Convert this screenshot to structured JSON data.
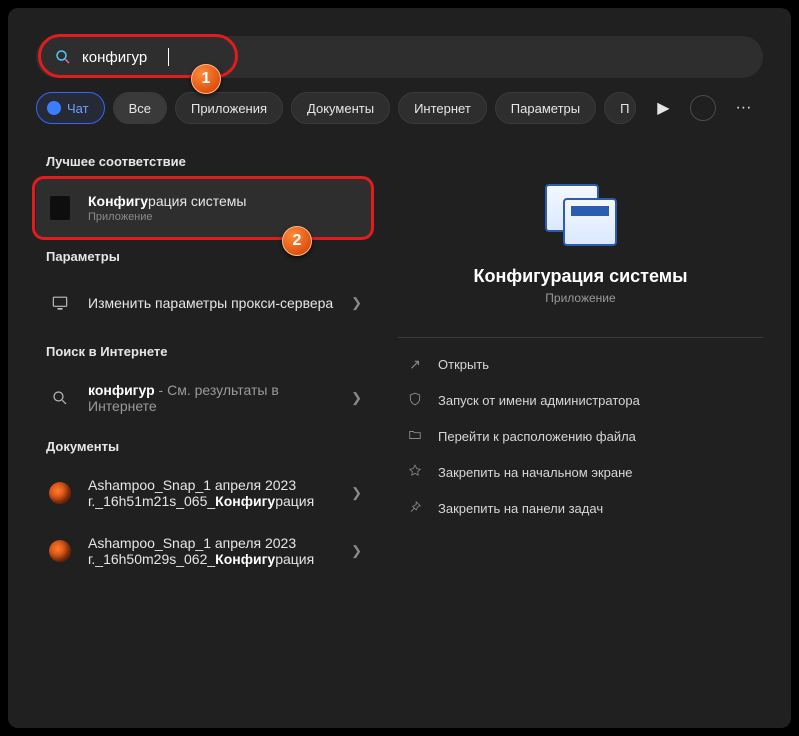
{
  "search": {
    "value": "конфигур"
  },
  "chips": {
    "chat": "Чат",
    "all": "Все",
    "apps": "Приложения",
    "docs": "Документы",
    "internet": "Интернет",
    "params": "Параметры",
    "partial": "П"
  },
  "sections": {
    "best": "Лучшее соответствие",
    "params": "Параметры",
    "web": "Поиск в Интернете",
    "docs": "Документы"
  },
  "left": {
    "best": {
      "title_prefix": "Конфигу",
      "title_rest": "рация системы",
      "sub": "Приложение"
    },
    "proxy": {
      "title": "Изменить параметры прокси-сервера"
    },
    "web": {
      "term_bold": "конфигур",
      "rest": " - См. результаты в Интернете"
    },
    "doc1": {
      "line1": "Ashampoo_Snap_1 апреля 2023",
      "line2_prefix": "г._16h51m21s_065_",
      "line2_bold": "Конфигу",
      "line2_rest": "рация"
    },
    "doc2": {
      "line1": "Ashampoo_Snap_1 апреля 2023",
      "line2_prefix": "г._16h50m29s_062_",
      "line2_bold": "Конфигу",
      "line2_rest": "рация"
    }
  },
  "details": {
    "title": "Конфигурация системы",
    "sub": "Приложение",
    "actions": {
      "open": "Открыть",
      "admin": "Запуск от имени администратора",
      "location": "Перейти к расположению файла",
      "pin_start": "Закрепить на начальном экране",
      "pin_taskbar": "Закрепить на панели задач"
    }
  }
}
